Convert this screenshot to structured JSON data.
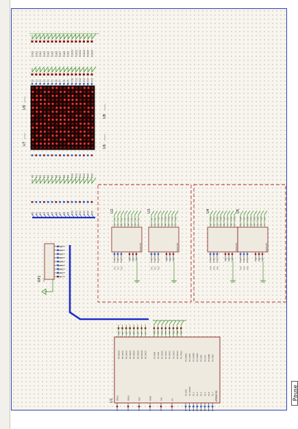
{
  "window": {
    "status_tab": "Pause"
  },
  "colors": {
    "wire": "#3f8c2c",
    "pin": "#8b1b1b",
    "chip_fill": "#eeeae0",
    "group_box": "#b53030",
    "bus": "#1e2ec8",
    "led_on": "#ff3030",
    "led_off": "#7a1010"
  },
  "matrix": {
    "labels": [
      "U7",
      "U6",
      "U9",
      "U8"
    ],
    "sublabel": "matrix",
    "rows": 16,
    "cols": 16
  },
  "top_connector": {
    "pins": [
      "COL0",
      "COL1",
      "COL2",
      "COL3",
      "COL4",
      "COL5",
      "COL6",
      "COL7",
      "COL8",
      "COL9",
      "COL10",
      "COL11",
      "COL12",
      "COL13",
      "COL14",
      "COL15"
    ]
  },
  "col_labels_upper": [
    "C0",
    "C1",
    "C2",
    "C3",
    "C4",
    "C5",
    "C6",
    "C7",
    "C8",
    "C9",
    "C10",
    "C11",
    "C12",
    "C13",
    "C14",
    "C15"
  ],
  "row_labels": [
    "R0",
    "R1",
    "R2",
    "R3",
    "R4",
    "R5",
    "R6",
    "R7",
    "R8",
    "R9",
    "R10",
    "R11",
    "R12",
    "R13",
    "R14",
    "R15"
  ],
  "resistor_pack": {
    "label": "RP1",
    "value": "4k7",
    "pins": [
      "D0",
      "D1",
      "D2",
      "D3",
      "D4",
      "D5",
      "D6",
      "D7",
      "R"
    ]
  },
  "decoders": [
    {
      "label": "U2",
      "type": "74HC138",
      "inputs": [
        "A",
        "B",
        "C"
      ],
      "enables": [
        "E1",
        "E2",
        "E3"
      ],
      "outputs": [
        "Y0",
        "Y1",
        "Y2",
        "Y3",
        "Y4",
        "Y5",
        "Y6",
        "Y7"
      ],
      "in_nets": [
        "P20",
        "P21",
        "P22"
      ]
    },
    {
      "label": "U3",
      "type": "74HC138",
      "inputs": [
        "A",
        "B",
        "C"
      ],
      "enables": [
        "E1",
        "E2",
        "E3"
      ],
      "outputs": [
        "Y0",
        "Y1",
        "Y2",
        "Y3",
        "Y4",
        "Y5",
        "Y6",
        "Y7"
      ],
      "in_nets": [
        "P20",
        "P21",
        "P22"
      ]
    },
    {
      "label": "U4",
      "type": "74HC138",
      "inputs": [
        "A",
        "B",
        "C"
      ],
      "enables": [
        "E1",
        "E2",
        "E3"
      ],
      "outputs": [
        "Y0",
        "Y1",
        "Y2",
        "Y3",
        "Y4",
        "Y5",
        "Y6",
        "Y7"
      ],
      "in_nets": [
        "P24",
        "P25",
        "P26"
      ]
    },
    {
      "label": "U5",
      "type": "74HC138",
      "inputs": [
        "A",
        "B",
        "C"
      ],
      "enables": [
        "E1",
        "E2",
        "E3"
      ],
      "outputs": [
        "Y0",
        "Y1",
        "Y2",
        "Y3",
        "Y4",
        "Y5",
        "Y6",
        "Y7"
      ],
      "in_nets": [
        "P24",
        "P25",
        "P26"
      ]
    }
  ],
  "mcu": {
    "label": "U1",
    "type": "AT89C52",
    "left_pins": [
      "XTAL1",
      "XTAL2",
      "RST",
      "PSEN",
      "ALE",
      "EA"
    ],
    "p0_pins": [
      "P0.0/AD0",
      "P0.1/AD1",
      "P0.2/AD2",
      "P0.3/AD3",
      "P0.4/AD4",
      "P0.5/AD5",
      "P0.6/AD6",
      "P0.7/AD7"
    ],
    "p2_pins": [
      "P2.0/A8",
      "P2.1/A9",
      "P2.2/A10",
      "P2.3/A11",
      "P2.4/A12",
      "P2.5/A13",
      "P2.6/A14",
      "P2.7/A15"
    ],
    "p3_pins": [
      "P3.0/RXD",
      "P3.1/TXD",
      "P3.2/INT0",
      "P3.3/INT1",
      "P3.4/T0",
      "P3.5/T1",
      "P3.6/WR",
      "P3.7/RD"
    ],
    "p1_pins": [
      "P1.0/T2",
      "P1.1/T2EX",
      "P1.2",
      "P1.3",
      "P1.4",
      "P1.5",
      "P1.6",
      "P1.7"
    ],
    "p0_nets": [
      "D0",
      "D1",
      "D2",
      "D3",
      "D4",
      "D5",
      "D6",
      "D7"
    ],
    "p2_nets": [
      "P20",
      "P21",
      "P22",
      "P23",
      "P24",
      "P25",
      "P26",
      "P27"
    ],
    "p3_nets": [
      "P30",
      "P31",
      "P32",
      "P33",
      "P34",
      "P35",
      "P36",
      "P37"
    ]
  }
}
